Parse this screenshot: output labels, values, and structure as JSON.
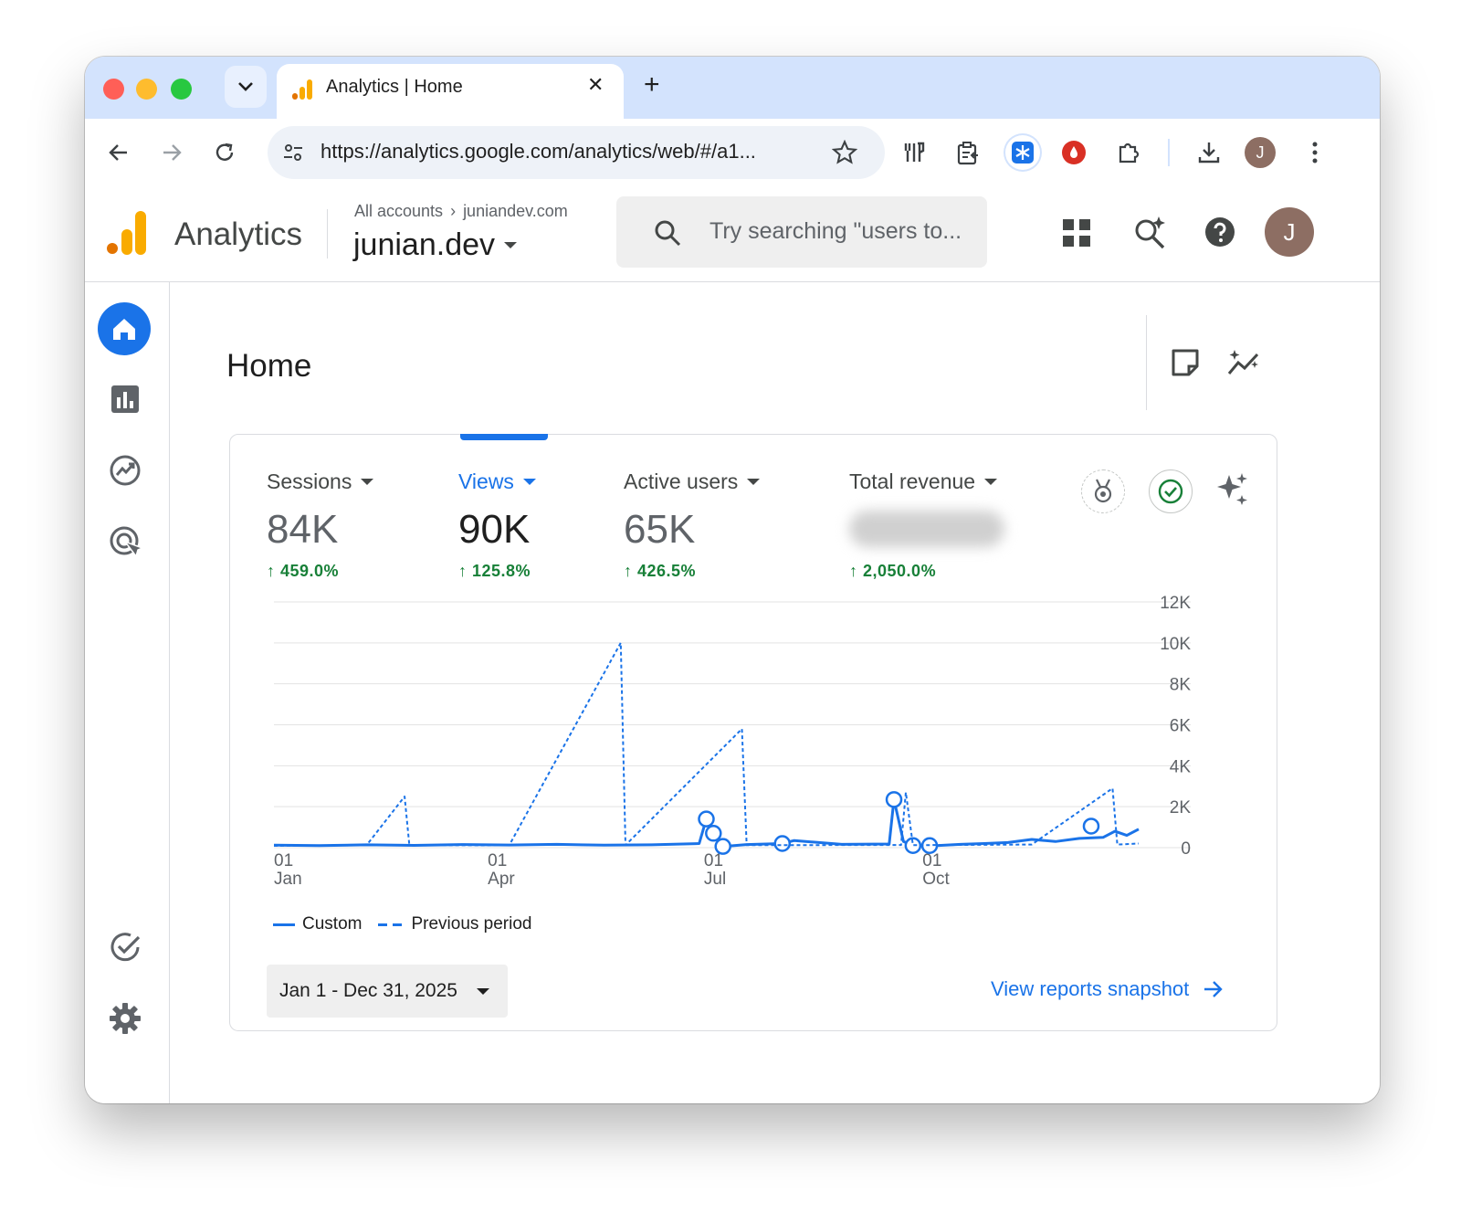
{
  "browser": {
    "tab_title": "Analytics | Home",
    "url": "https://analytics.google.com/analytics/web/#/a1...",
    "profile_initial": "J"
  },
  "header": {
    "product_name": "Analytics",
    "breadcrumb_root": "All accounts",
    "breadcrumb_account": "juniandev.com",
    "property_name": "junian.dev",
    "search_placeholder": "Try searching \"users to...",
    "avatar_initial": "J"
  },
  "page": {
    "title": "Home"
  },
  "metrics": [
    {
      "name": "Sessions",
      "value": "84K",
      "change": "459.0%",
      "selected": false
    },
    {
      "name": "Views",
      "value": "90K",
      "change": "125.8%",
      "selected": true
    },
    {
      "name": "Active users",
      "value": "65K",
      "change": "426.5%",
      "selected": false
    },
    {
      "name": "Total revenue",
      "value": "",
      "change": "2,050.0%",
      "selected": false
    }
  ],
  "chart_data": {
    "type": "line",
    "y_ticks": [
      "12K",
      "10K",
      "8K",
      "6K",
      "4K",
      "2K",
      "0"
    ],
    "ylim": [
      0,
      12000
    ],
    "x_ticks": [
      {
        "day": "01",
        "month": "Jan"
      },
      {
        "day": "01",
        "month": "Apr"
      },
      {
        "day": "01",
        "month": "Jul"
      },
      {
        "day": "01",
        "month": "Oct"
      }
    ],
    "series": [
      {
        "name": "Custom",
        "style": "solid",
        "color": "#1a73e8",
        "points": [
          [
            1,
            120
          ],
          [
            20,
            100
          ],
          [
            40,
            140
          ],
          [
            60,
            110
          ],
          [
            80,
            150
          ],
          [
            100,
            130
          ],
          [
            120,
            160
          ],
          [
            140,
            120
          ],
          [
            160,
            140
          ],
          [
            180,
            200
          ],
          [
            183,
            1400
          ],
          [
            186,
            700
          ],
          [
            190,
            60
          ],
          [
            200,
            150
          ],
          [
            215,
            200
          ],
          [
            220,
            350
          ],
          [
            240,
            160
          ],
          [
            260,
            180
          ],
          [
            262,
            2350
          ],
          [
            266,
            300
          ],
          [
            270,
            100
          ],
          [
            280,
            100
          ],
          [
            290,
            160
          ],
          [
            300,
            200
          ],
          [
            310,
            250
          ],
          [
            320,
            400
          ],
          [
            330,
            300
          ],
          [
            340,
            450
          ],
          [
            350,
            500
          ],
          [
            355,
            800
          ],
          [
            360,
            600
          ],
          [
            365,
            900
          ]
        ],
        "markers": [
          [
            183,
            1400
          ],
          [
            186,
            700
          ],
          [
            190,
            60
          ],
          [
            215,
            200
          ],
          [
            262,
            2350
          ],
          [
            270,
            100
          ],
          [
            277,
            100
          ],
          [
            345,
            1050
          ]
        ]
      },
      {
        "name": "Previous period",
        "style": "dashed",
        "color": "#1a73e8",
        "points": [
          [
            1,
            90
          ],
          [
            40,
            120
          ],
          [
            56,
            2500
          ],
          [
            58,
            120
          ],
          [
            100,
            110
          ],
          [
            147,
            10000
          ],
          [
            149,
            120
          ],
          [
            198,
            5800
          ],
          [
            200,
            120
          ],
          [
            260,
            130
          ],
          [
            265,
            130
          ],
          [
            267,
            2700
          ],
          [
            270,
            120
          ],
          [
            320,
            150
          ],
          [
            354,
            2900
          ],
          [
            356,
            150
          ],
          [
            365,
            200
          ]
        ]
      }
    ]
  },
  "legend": {
    "custom_label": "Custom",
    "previous_label": "Previous period"
  },
  "footer": {
    "date_range": "Jan 1 - Dec 31, 2025",
    "snapshot_link": "View reports snapshot"
  }
}
